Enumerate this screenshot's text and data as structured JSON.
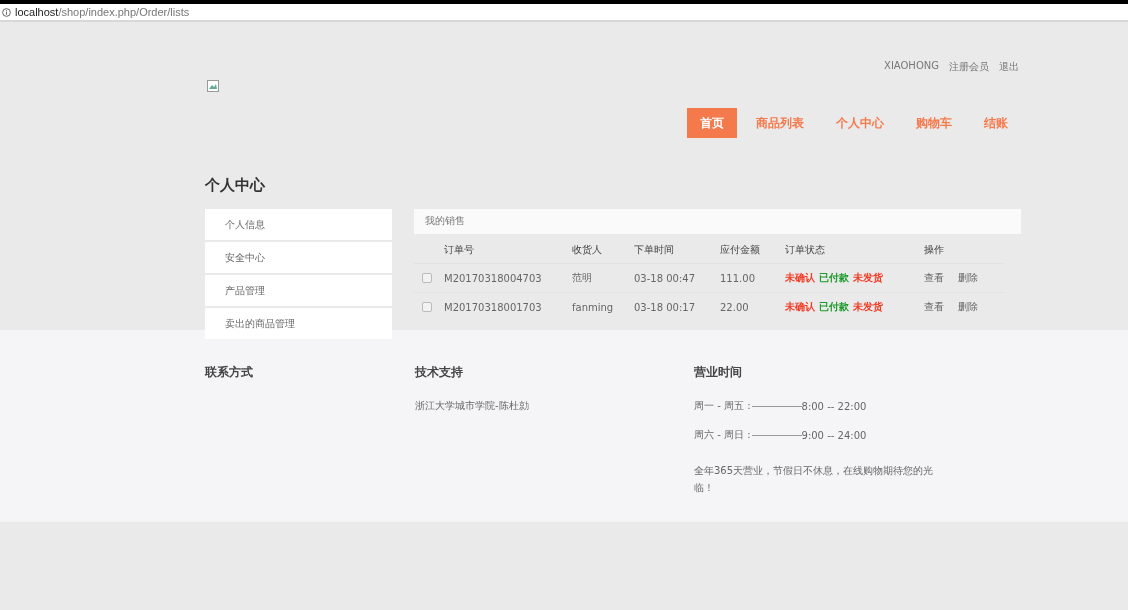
{
  "address_bar": {
    "host": "localhost",
    "path": "/shop/index.php/Order/lists"
  },
  "user_links": [
    "XIAOHONG",
    "注册会员",
    "退出"
  ],
  "nav": [
    {
      "label": "首页",
      "selected": true
    },
    {
      "label": "商品列表",
      "selected": false
    },
    {
      "label": "个人中心",
      "selected": false
    },
    {
      "label": "购物车",
      "selected": false
    },
    {
      "label": "结账",
      "selected": false
    }
  ],
  "page_title": "个人中心",
  "sidebar": {
    "items": [
      "个人信息",
      "安全中心",
      "产品管理",
      "卖出的商品管理"
    ]
  },
  "panel": {
    "title": "我的销售",
    "columns": [
      "订单号",
      "收货人",
      "下单时间",
      "应付金额",
      "订单状态",
      "操作"
    ],
    "rows": [
      {
        "checked": false,
        "order_no": "M20170318004703",
        "receiver": "范明",
        "time": "03-18 00:47",
        "amount": "111.00",
        "status": [
          {
            "text": "未确认",
            "color": "#f03a24"
          },
          {
            "text": "已付款",
            "color": "#1e9a2c"
          },
          {
            "text": "未发货",
            "color": "#f03a24"
          }
        ],
        "actions": [
          "查看",
          "删除"
        ]
      },
      {
        "checked": false,
        "order_no": "M20170318001703",
        "receiver": "fanming",
        "time": "03-18 00:17",
        "amount": "22.00",
        "status": [
          {
            "text": "未确认",
            "color": "#f03a24"
          },
          {
            "text": "已付款",
            "color": "#1e9a2c"
          },
          {
            "text": "未发货",
            "color": "#f03a24"
          }
        ],
        "actions": [
          "查看",
          "删除"
        ]
      }
    ]
  },
  "footer": {
    "contact": {
      "title": "联系方式"
    },
    "support": {
      "title": "技术支持",
      "text": "浙江大学城市学院-陈杜勍"
    },
    "hours": {
      "title": "营业时间",
      "lines": [
        {
          "days": "周一 - 周五 :",
          "time": "8:00 -- 22:00"
        },
        {
          "days": "周六 - 周日 :",
          "time": "9:00 -- 24:00"
        }
      ],
      "note": "全年365天营业，节假日不休息，在线购物期待您的光临！"
    }
  }
}
